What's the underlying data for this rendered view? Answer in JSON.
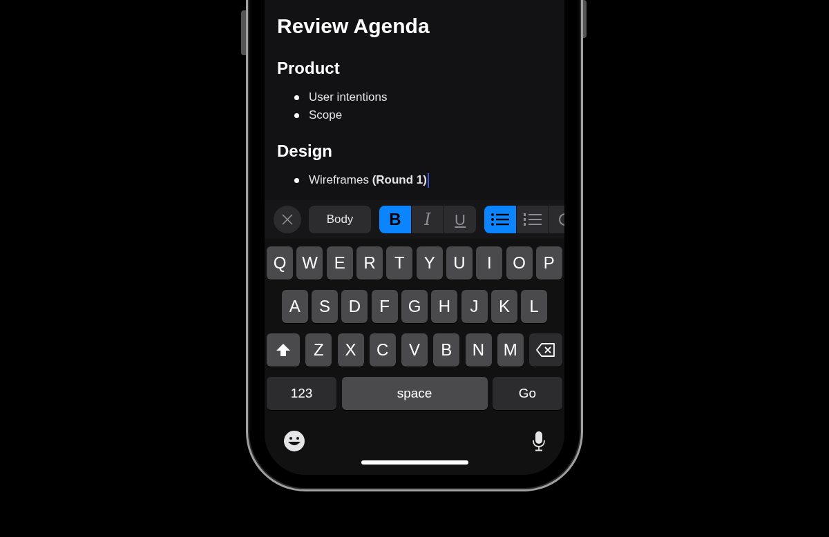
{
  "note": {
    "title": "Review Agenda",
    "sections": [
      {
        "heading": "Product",
        "items": [
          {
            "text": "User intentions",
            "cursor": false
          },
          {
            "text": "Scope",
            "cursor": false
          }
        ]
      },
      {
        "heading": "Design",
        "items": [
          {
            "text": "Wireframes **(Round 1)**",
            "cursor": true
          }
        ]
      }
    ]
  },
  "toolbar": {
    "style_button": "Body",
    "format_buttons": [
      {
        "kind": "bold",
        "label": "B",
        "selected": true
      },
      {
        "kind": "italic",
        "label": "I",
        "selected": false
      },
      {
        "kind": "underline",
        "label": "U",
        "selected": false
      }
    ],
    "list_buttons": [
      {
        "kind": "bulleted",
        "selected": true
      },
      {
        "kind": "numbered",
        "selected": false
      }
    ],
    "cut_off_button": {
      "kind": "checklist"
    }
  },
  "keyboard": {
    "rows": [
      {
        "keys": [
          {
            "kind": "letter",
            "label": "Q"
          },
          {
            "kind": "letter",
            "label": "W"
          },
          {
            "kind": "letter",
            "label": "E"
          },
          {
            "kind": "letter",
            "label": "R"
          },
          {
            "kind": "letter",
            "label": "T"
          },
          {
            "kind": "letter",
            "label": "Y"
          },
          {
            "kind": "letter",
            "label": "U"
          },
          {
            "kind": "letter",
            "label": "I"
          },
          {
            "kind": "letter",
            "label": "O"
          },
          {
            "kind": "letter",
            "label": "P"
          }
        ]
      },
      {
        "keys": [
          {
            "kind": "letter",
            "label": "A"
          },
          {
            "kind": "letter",
            "label": "S"
          },
          {
            "kind": "letter",
            "label": "D"
          },
          {
            "kind": "letter",
            "label": "F"
          },
          {
            "kind": "letter",
            "label": "G"
          },
          {
            "kind": "letter",
            "label": "H"
          },
          {
            "kind": "letter",
            "label": "J"
          },
          {
            "kind": "letter",
            "label": "K"
          },
          {
            "kind": "letter",
            "label": "L"
          }
        ]
      },
      {
        "keys": [
          {
            "kind": "shift"
          },
          {
            "kind": "letter",
            "label": "Z"
          },
          {
            "kind": "letter",
            "label": "X"
          },
          {
            "kind": "letter",
            "label": "C"
          },
          {
            "kind": "letter",
            "label": "V"
          },
          {
            "kind": "letter",
            "label": "B"
          },
          {
            "kind": "letter",
            "label": "N"
          },
          {
            "kind": "letter",
            "label": "M"
          },
          {
            "kind": "backspace"
          }
        ]
      },
      {
        "keys": [
          {
            "kind": "mode",
            "label": "123"
          },
          {
            "kind": "space",
            "label": "space"
          },
          {
            "kind": "return",
            "label": "Go"
          }
        ]
      }
    ]
  }
}
